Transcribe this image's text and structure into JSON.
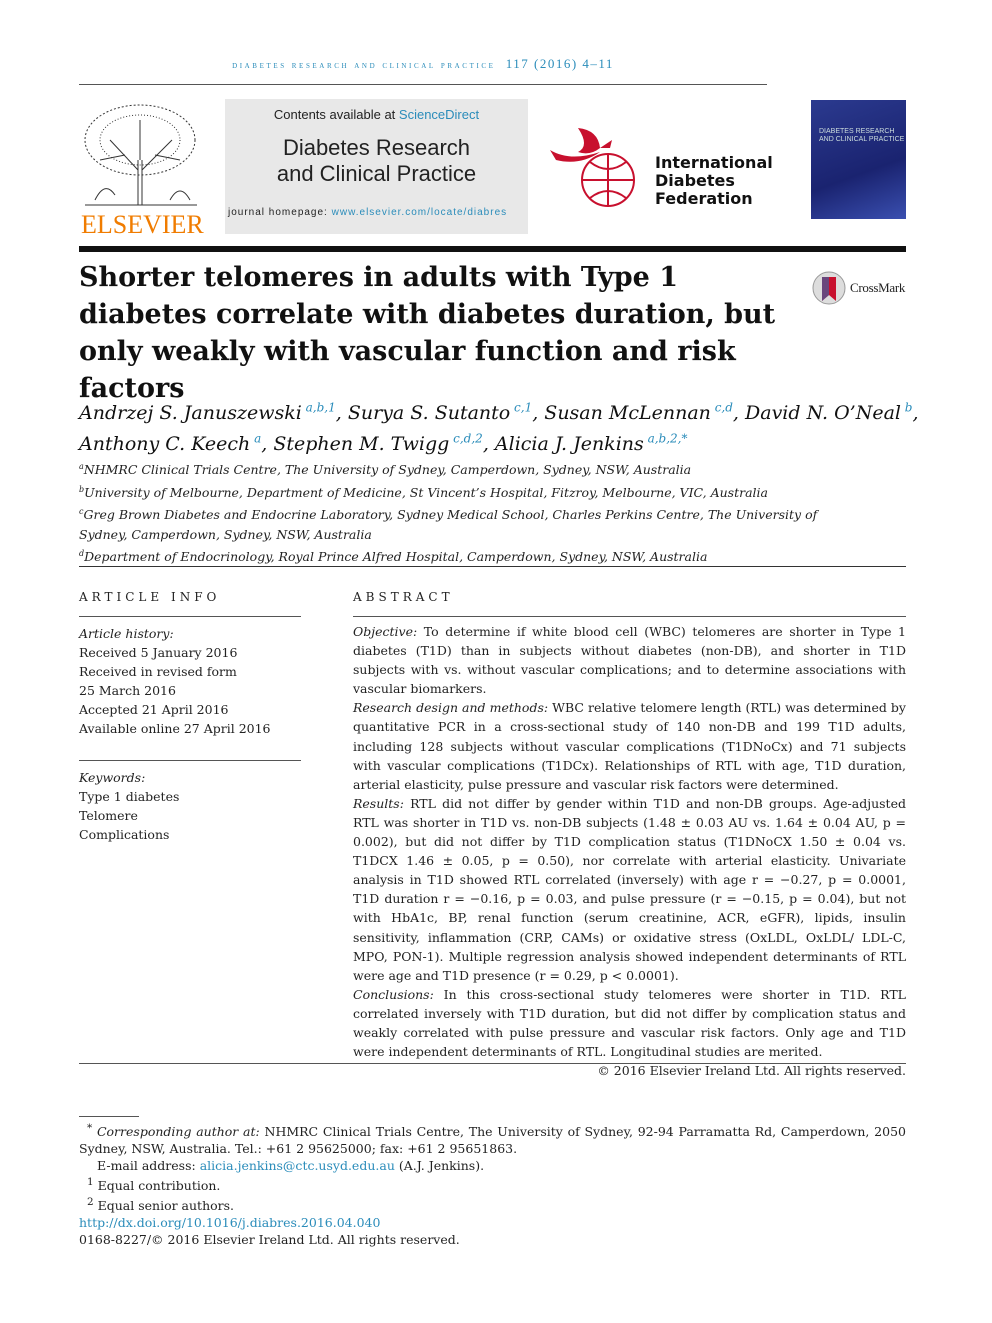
{
  "header": {
    "journal_running": "diabetes research and clinical practice",
    "volume": "117 (2016) 4–11"
  },
  "banner": {
    "contents_prefix": "Contents available at ",
    "sciencedirect": "ScienceDirect",
    "journal_title_line1": "Diabetes Research",
    "journal_title_line2": "and Clinical Practice",
    "homepage_label": "journal homepage: ",
    "homepage_url": "www.elsevier.com/locate/diabres"
  },
  "logos": {
    "publisher": "ELSEVIER",
    "idf_line1": "International",
    "idf_line2": "Diabetes",
    "idf_line3": "Federation",
    "cover_text": "DIABETES RESEARCH AND CLINICAL PRACTICE",
    "crossmark": "CrossMark",
    "publisher_color": "#f07c00",
    "accent_color": "#2a8cba"
  },
  "article": {
    "title": "Shorter telomeres in adults with Type 1 diabetes correlate with diabetes duration, but only weakly with vascular function and risk factors"
  },
  "authors": [
    {
      "name": "Andrzej S. Januszewski",
      "aff": "a,b,1",
      "sep": ", "
    },
    {
      "name": "Surya S. Sutanto",
      "aff": "c,1",
      "sep": ", "
    },
    {
      "name": "Susan McLennan",
      "aff": "c,d",
      "sep": ", "
    },
    {
      "name": "David N. O’Neal",
      "aff": "b",
      "sep": ","
    },
    {
      "name": "Anthony C. Keech",
      "aff": "a",
      "sep": ", "
    },
    {
      "name": "Stephen M. Twigg",
      "aff": "c,d,2",
      "sep": ", "
    },
    {
      "name": "Alicia J. Jenkins",
      "aff": "a,b,2,*",
      "sep": ""
    }
  ],
  "affiliations": [
    {
      "key": "a",
      "text": "NHMRC Clinical Trials Centre, The University of Sydney, Camperdown, Sydney, NSW, Australia"
    },
    {
      "key": "b",
      "text": "University of Melbourne, Department of Medicine, St Vincent’s Hospital, Fitzroy, Melbourne, VIC, Australia"
    },
    {
      "key": "c",
      "text": "Greg Brown Diabetes and Endocrine Laboratory, Sydney Medical School, Charles Perkins Centre, The University of Sydney, Camperdown, Sydney, NSW, Australia"
    },
    {
      "key": "d",
      "text": "Department of Endocrinology, Royal Prince Alfred Hospital, Camperdown, Sydney, NSW, Australia"
    }
  ],
  "article_info": {
    "heading": "ARTICLE INFO",
    "history_label": "Article history:",
    "history": [
      "Received 5 January 2016",
      "Received in revised form",
      "25 March 2016",
      "Accepted 21 April 2016",
      "Available online 27 April 2016"
    ],
    "keywords_label": "Keywords:",
    "keywords": [
      "Type 1 diabetes",
      "Telomere",
      "Complications"
    ]
  },
  "abstract": {
    "heading": "ABSTRACT",
    "sections": [
      {
        "label": "Objective:",
        "text": "To determine if white blood cell (WBC) telomeres are shorter in Type 1 diabetes (T1D) than in subjects without diabetes (non-DB), and shorter in T1D subjects with vs. without vascular complications; and to determine associations with vascular biomarkers."
      },
      {
        "label": "Research design and methods:",
        "text": "WBC relative telomere length (RTL) was determined by quantitative PCR in a cross-sectional study of 140 non-DB and 199 T1D adults, including 128 subjects without vascular complications (T1DNoCx) and 71 subjects with vascular complications (T1DCx). Relationships of RTL with age, T1D duration, arterial elasticity, pulse pressure and vascular risk factors were determined."
      },
      {
        "label": "Results:",
        "text": "RTL did not differ by gender within T1D and non-DB groups. Age-adjusted RTL was shorter in T1D vs. non-DB subjects (1.48 ± 0.03 AU vs. 1.64 ± 0.04 AU, p = 0.002), but did not differ by T1D complication status (T1DNoCX 1.50 ± 0.04 vs. T1DCX 1.46 ± 0.05, p = 0.50), nor correlate with arterial elasticity. Univariate analysis in T1D showed RTL correlated (inver­sely) with age r = −0.27, p = 0.0001, T1D duration r = −0.16, p = 0.03, and pulse pressure (r = −0.15, p = 0.04), but not with HbA1c, BP, renal function (serum creatinine, ACR, eGFR), lipids, insulin sensitivity, inflammation (CRP, CAMs) or oxidative stress (OxLDL, OxLDL/ LDL-C, MPO, PON-1). Multiple regression analysis showed independent determinants of RTL were age and T1D presence (r = 0.29, p < 0.0001)."
      },
      {
        "label": "Conclusions:",
        "text": "In this cross-sectional study telomeres were shorter in T1D. RTL correlated inversely with T1D duration, but did not differ by complication status and weakly corre­lated with pulse pressure and vascular risk factors. Only age and T1D were independent determinants of RTL. Longitudinal studies are merited."
      }
    ],
    "copyright": "© 2016 Elsevier Ireland Ltd. All rights reserved."
  },
  "footnotes": {
    "corresponding_label": "Corresponding author at:",
    "corresponding_text": "NHMRC Clinical Trials Centre, The University of Sydney, 92-94 Parramatta Rd, Camperdown, 2050 Sydney, NSW, Australia. Tel.: +61 2 95625000; fax: +61 2 95651863.",
    "email_label": "E-mail address: ",
    "email": "alicia.jenkins@ctc.usyd.edu.au",
    "email_suffix": " (A.J. Jenkins).",
    "note1": "Equal contribution.",
    "note2": "Equal senior authors.",
    "doi": "http://dx.doi.org/10.1016/j.diabres.2016.04.040",
    "issn": "0168-8227/© 2016 Elsevier Ireland Ltd. All rights reserved."
  }
}
